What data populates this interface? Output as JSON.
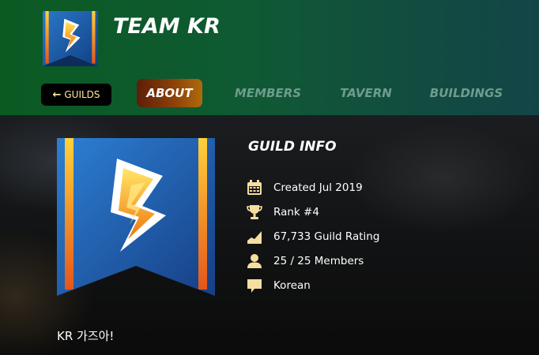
{
  "header": {
    "team_name": "TEAM KR",
    "back_button": "GUILDS"
  },
  "tabs": [
    {
      "label": "ABOUT",
      "active": true
    },
    {
      "label": "MEMBERS",
      "active": false
    },
    {
      "label": "TAVERN",
      "active": false
    },
    {
      "label": "BUILDINGS",
      "active": false
    }
  ],
  "guild_info": {
    "title": "GUILD INFO",
    "items": [
      {
        "icon": "calendar-icon",
        "text": "Created Jul 2019"
      },
      {
        "icon": "trophy-icon",
        "text": "Rank #4"
      },
      {
        "icon": "rating-chart-icon",
        "text": "67,733 Guild Rating"
      },
      {
        "icon": "member-icon",
        "text": "25 / 25 Members"
      },
      {
        "icon": "language-icon",
        "text": "Korean"
      }
    ]
  },
  "motto": "KR 가즈아!",
  "colors": {
    "accent_text": "#ffe79a",
    "icon_color": "#f5dea0",
    "banner_blue": "#1f5fb0",
    "active_tab": "#8a4008"
  }
}
